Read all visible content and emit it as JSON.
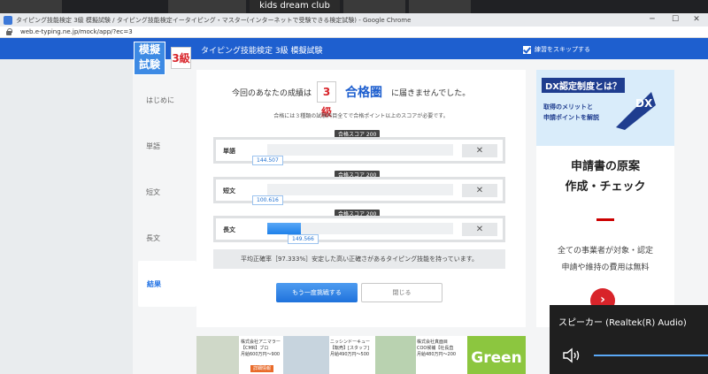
{
  "zoom_bar": {
    "participant_name": "kids dream club"
  },
  "browser": {
    "window_title": "タイピング技能検定 3級 模擬試験 / タイピング技能検定イータイピング・マスター(インターネットで受験できる検定試験) - Google Chrome",
    "url": "web.e-typing.ne.jp/mock/app/?ec=3"
  },
  "header": {
    "logo_line1": "模擬",
    "logo_line2": "試験",
    "level_badge": "3級",
    "title": "タイピング技能検定 3級 模擬試験",
    "skip_label": "練習をスキップする"
  },
  "nav": {
    "items": [
      {
        "label": "はじめに"
      },
      {
        "label": "単語"
      },
      {
        "label": "短文"
      },
      {
        "label": "長文"
      },
      {
        "label": "結果"
      }
    ]
  },
  "result": {
    "headline_prefix": "今回のあなたの成績は",
    "badge": "3級",
    "pass_word": "合格圏",
    "headline_suffix": "に届きませんでした。",
    "note": "合格には３種類の試験科目全てで合格ポイント以上のスコアが必要です。",
    "pass_score_label": "合格スコア 200",
    "close_symbol": "✕",
    "rows": [
      {
        "label": "単語",
        "score": 144.507,
        "score_text": "144.507",
        "fill": 0.0
      },
      {
        "label": "短文",
        "score": 100.616,
        "score_text": "100.616",
        "fill": 0.0
      },
      {
        "label": "長文",
        "score": 149.566,
        "score_text": "149.566",
        "fill": 0.18
      }
    ],
    "average": "平均正確率［97.333%］安定した高い正確さがあるタイピング技能を持っています。",
    "retry_button": "もう一度挑戦する",
    "close_button": "閉じる"
  },
  "ad_right": {
    "title": "DX認定制度とは？",
    "line1": "取得のメリットと",
    "line2": "申請ポイントを解説",
    "dx_text": "DX",
    "big1": "申請書の原案",
    "big2": "作成・チェック",
    "small1": "全ての事業者が対象・認定",
    "small2": "申請や維持の費用は無料",
    "arrow": "›"
  },
  "ad_bottom": {
    "item1_l1": "株式会社アニマラー",
    "item1_l2": "【CMR】ブロ",
    "item1_l3": "月給600万円〜900",
    "item1_btn": "詳細情報",
    "item2_l1": "ニッシンドーキュー",
    "item2_l2": "【転売】[スタッフ]",
    "item2_l3": "月給490万円〜500",
    "item3_l1": "株式会社真面目",
    "item3_l2": "COO候補【社長直",
    "item3_l3": "月給480万円〜200",
    "green_text": "Green"
  },
  "speaker_popup": {
    "title": "スピーカー (Realtek(R) Audio)"
  },
  "colors": {
    "brand_blue": "#1e5fcf",
    "pass_red": "#d8242a",
    "fill_blue": "#1e80ea"
  }
}
